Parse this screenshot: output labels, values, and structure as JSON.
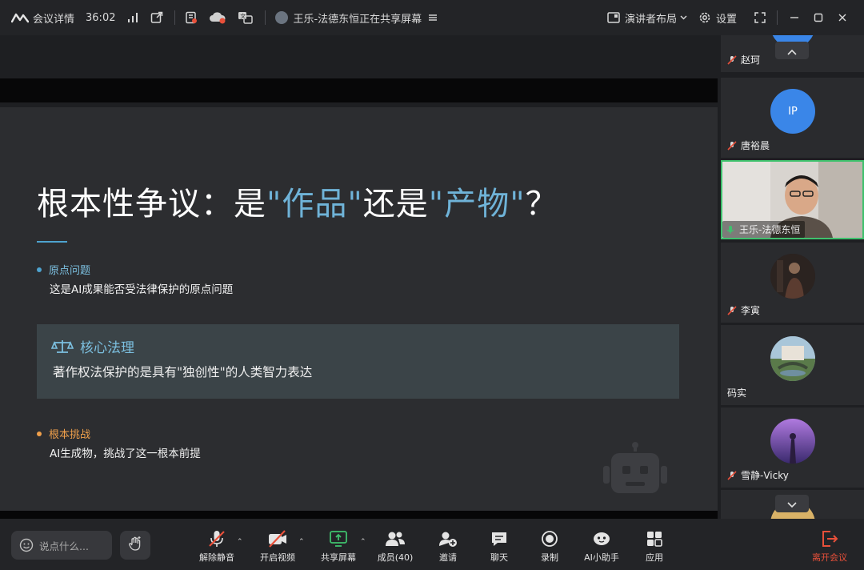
{
  "topbar": {
    "meeting_info": "会议详情",
    "timer": "36:02",
    "sharing_status": "王乐-法德东恒正在共享屏幕",
    "layout_label": "演讲者布局",
    "settings_label": "设置"
  },
  "slide": {
    "title_part1": "根本性争议：是",
    "title_hl1": "\"作品\"",
    "title_part2": "还是",
    "title_hl2": "\"产物\"",
    "title_part3": "？",
    "bullet1_head": "原点问题",
    "bullet1_text": "这是AI成果能否受法律保护的原点问题",
    "callout_title": "核心法理",
    "callout_text": "著作权法保护的是具有\"独创性\"的人类智力表达",
    "bullet2_head": "根本挑战",
    "bullet2_text": "AI生成物，挑战了这一根本前提",
    "colors": {
      "accent_blue": "#4ea3cf",
      "accent_orange": "#f0a04b"
    }
  },
  "participants": [
    {
      "name": "赵珂",
      "muted": true
    },
    {
      "name": "唐裕晨",
      "initials": "IP",
      "muted": true
    },
    {
      "name": "王乐-法德东恒",
      "speaking": true
    },
    {
      "name": "李寅",
      "muted": true
    },
    {
      "name": "码实",
      "muted": false
    },
    {
      "name": "雪静-Vicky",
      "muted": true
    }
  ],
  "toolbar": {
    "chat_placeholder": "说点什么...",
    "unmute": "解除静音",
    "video": "开启视频",
    "share": "共享屏幕",
    "members": "成员(40)",
    "invite": "邀请",
    "chat": "聊天",
    "record": "录制",
    "ai_assistant": "AI小助手",
    "apps": "应用",
    "leave": "离开会议",
    "colors": {
      "leave": "#e8503a",
      "share_green": "#3fc16d"
    }
  }
}
